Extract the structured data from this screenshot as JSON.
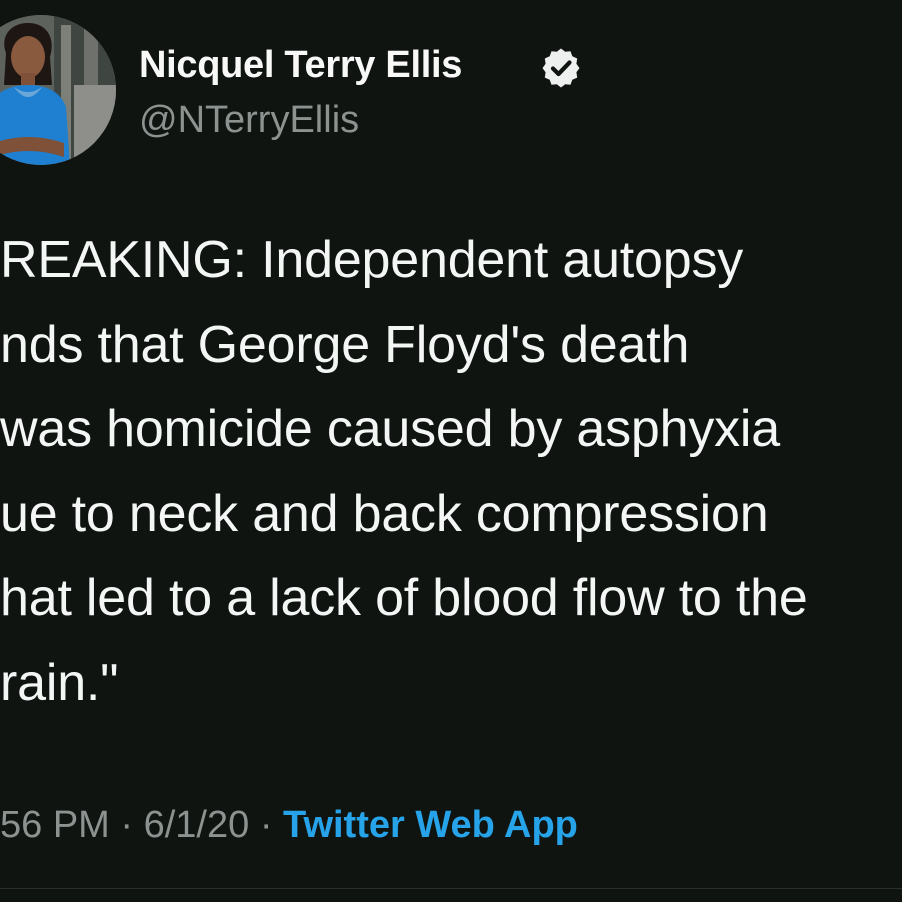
{
  "author": {
    "display_name": "Nicquel Terry Ellis",
    "handle": "@NTerryEllis",
    "verified": true,
    "verified_icon": "verified-badge-icon",
    "avatar": "profile-photo"
  },
  "tweet": {
    "lines": [
      "REAKING: Independent autopsy",
      "nds that George Floyd's death",
      "was homicide caused by asphyxia",
      "ue to neck and back compression",
      "hat led to a lack of blood flow to the",
      "rain.\""
    ]
  },
  "meta": {
    "time": "56 PM",
    "separator": "·",
    "date": "6/1/20",
    "source": "Twitter Web App"
  },
  "colors": {
    "background": "#0f1411",
    "text": "#f4f6f5",
    "secondary_text": "#8b9290",
    "link": "#27a3ea"
  }
}
